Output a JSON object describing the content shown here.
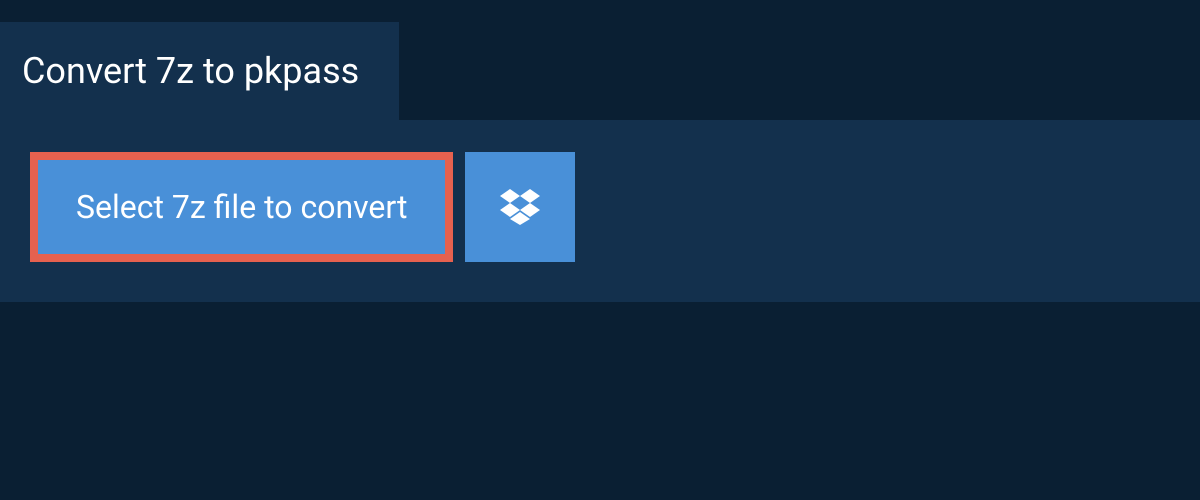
{
  "tab": {
    "title": "Convert 7z to pkpass"
  },
  "buttons": {
    "select_label": "Select 7z file to convert"
  },
  "colors": {
    "background": "#0a1f33",
    "panel": "#13304d",
    "button": "#4990d8",
    "highlight_border": "#e6614f",
    "text": "#ffffff"
  }
}
